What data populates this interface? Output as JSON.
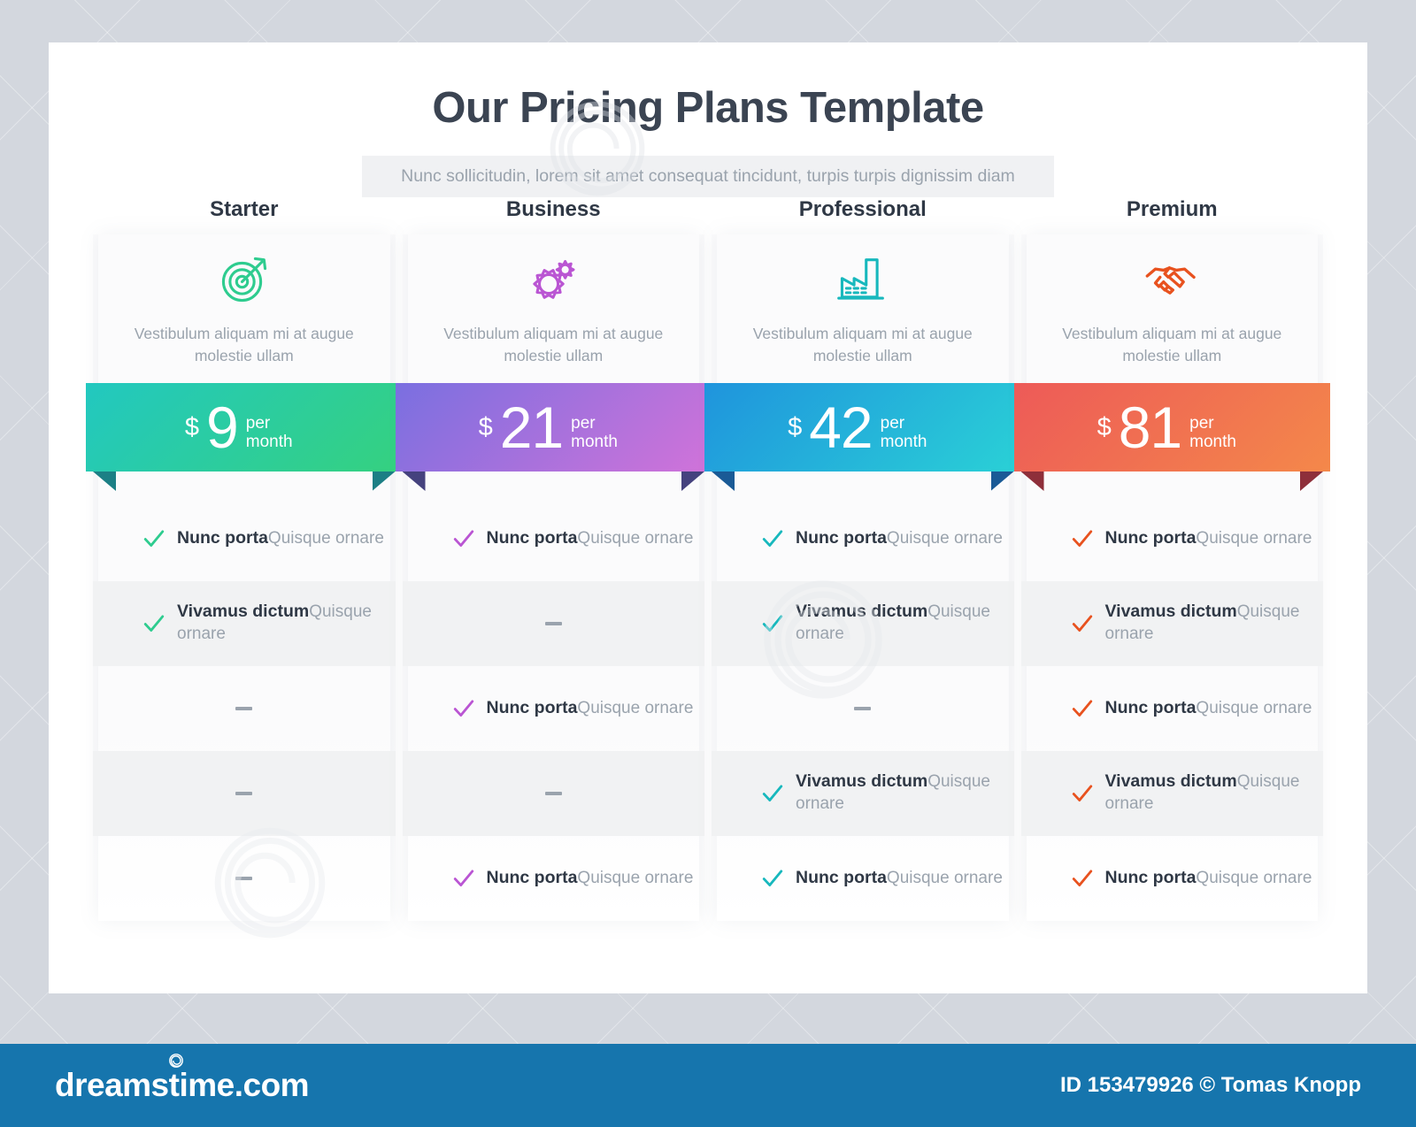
{
  "header": {
    "title": "Our Pricing Plans Template",
    "subtitle": "Nunc sollicitudin, lorem sit amet consequat tincidunt, turpis turpis dignissim diam"
  },
  "currency_symbol": "$",
  "per_label_line1": "per",
  "per_label_line2": "month",
  "plans": [
    {
      "name": "Starter",
      "icon": "target-icon",
      "description": "Vestibulum aliquam mi at augue molestie ullam",
      "price": "9",
      "accent": "#2ecc8f",
      "gradient_from": "#22c8c0",
      "gradient_to": "#35d17f",
      "fold_color": "#1c7f85",
      "features": [
        {
          "available": true,
          "title": "Nunc porta",
          "subtitle": "Quisque ornare"
        },
        {
          "available": true,
          "title": "Vivamus dictum",
          "subtitle": "Quisque ornare"
        },
        {
          "available": false,
          "title": "",
          "subtitle": ""
        },
        {
          "available": false,
          "title": "",
          "subtitle": ""
        },
        {
          "available": false,
          "title": "",
          "subtitle": ""
        }
      ]
    },
    {
      "name": "Business",
      "icon": "gears-icon",
      "description": "Vestibulum aliquam mi at augue molestie ullam",
      "price": "21",
      "accent": "#ba55d3",
      "gradient_from": "#7a6fe0",
      "gradient_to": "#d173d9",
      "fold_color": "#45427e",
      "features": [
        {
          "available": true,
          "title": "Nunc porta",
          "subtitle": "Quisque ornare"
        },
        {
          "available": false,
          "title": "",
          "subtitle": ""
        },
        {
          "available": true,
          "title": "Nunc porta",
          "subtitle": "Quisque ornare"
        },
        {
          "available": false,
          "title": "",
          "subtitle": ""
        },
        {
          "available": true,
          "title": "Nunc porta",
          "subtitle": "Quisque ornare"
        }
      ]
    },
    {
      "name": "Professional",
      "icon": "factory-icon",
      "description": "Vestibulum aliquam mi at augue molestie ullam",
      "price": "42",
      "accent": "#17b8bd",
      "gradient_from": "#1f94dd",
      "gradient_to": "#2ad1d6",
      "fold_color": "#1a5a96",
      "features": [
        {
          "available": true,
          "title": "Nunc porta",
          "subtitle": "Quisque ornare"
        },
        {
          "available": true,
          "title": "Vivamus dictum",
          "subtitle": "Quisque ornare"
        },
        {
          "available": false,
          "title": "",
          "subtitle": ""
        },
        {
          "available": true,
          "title": "Vivamus dictum",
          "subtitle": "Quisque ornare"
        },
        {
          "available": true,
          "title": "Nunc porta",
          "subtitle": "Quisque ornare"
        }
      ]
    },
    {
      "name": "Premium",
      "icon": "handshake-icon",
      "description": "Vestibulum aliquam mi at augue molestie ullam",
      "price": "81",
      "accent": "#e8521f",
      "gradient_from": "#ed5a58",
      "gradient_to": "#f4884a",
      "fold_color": "#8e2f3a",
      "features": [
        {
          "available": true,
          "title": "Nunc porta",
          "subtitle": "Quisque ornare"
        },
        {
          "available": true,
          "title": "Vivamus dictum",
          "subtitle": "Quisque ornare"
        },
        {
          "available": true,
          "title": "Nunc porta",
          "subtitle": "Quisque ornare"
        },
        {
          "available": true,
          "title": "Vivamus dictum",
          "subtitle": "Quisque ornare"
        },
        {
          "available": true,
          "title": "Nunc porta",
          "subtitle": "Quisque ornare"
        }
      ]
    }
  ],
  "footer": {
    "logo_text": "dreamstime.com",
    "credit": "ID 153479926 © Tomas Knopp",
    "bar_color": "#1675ad"
  }
}
